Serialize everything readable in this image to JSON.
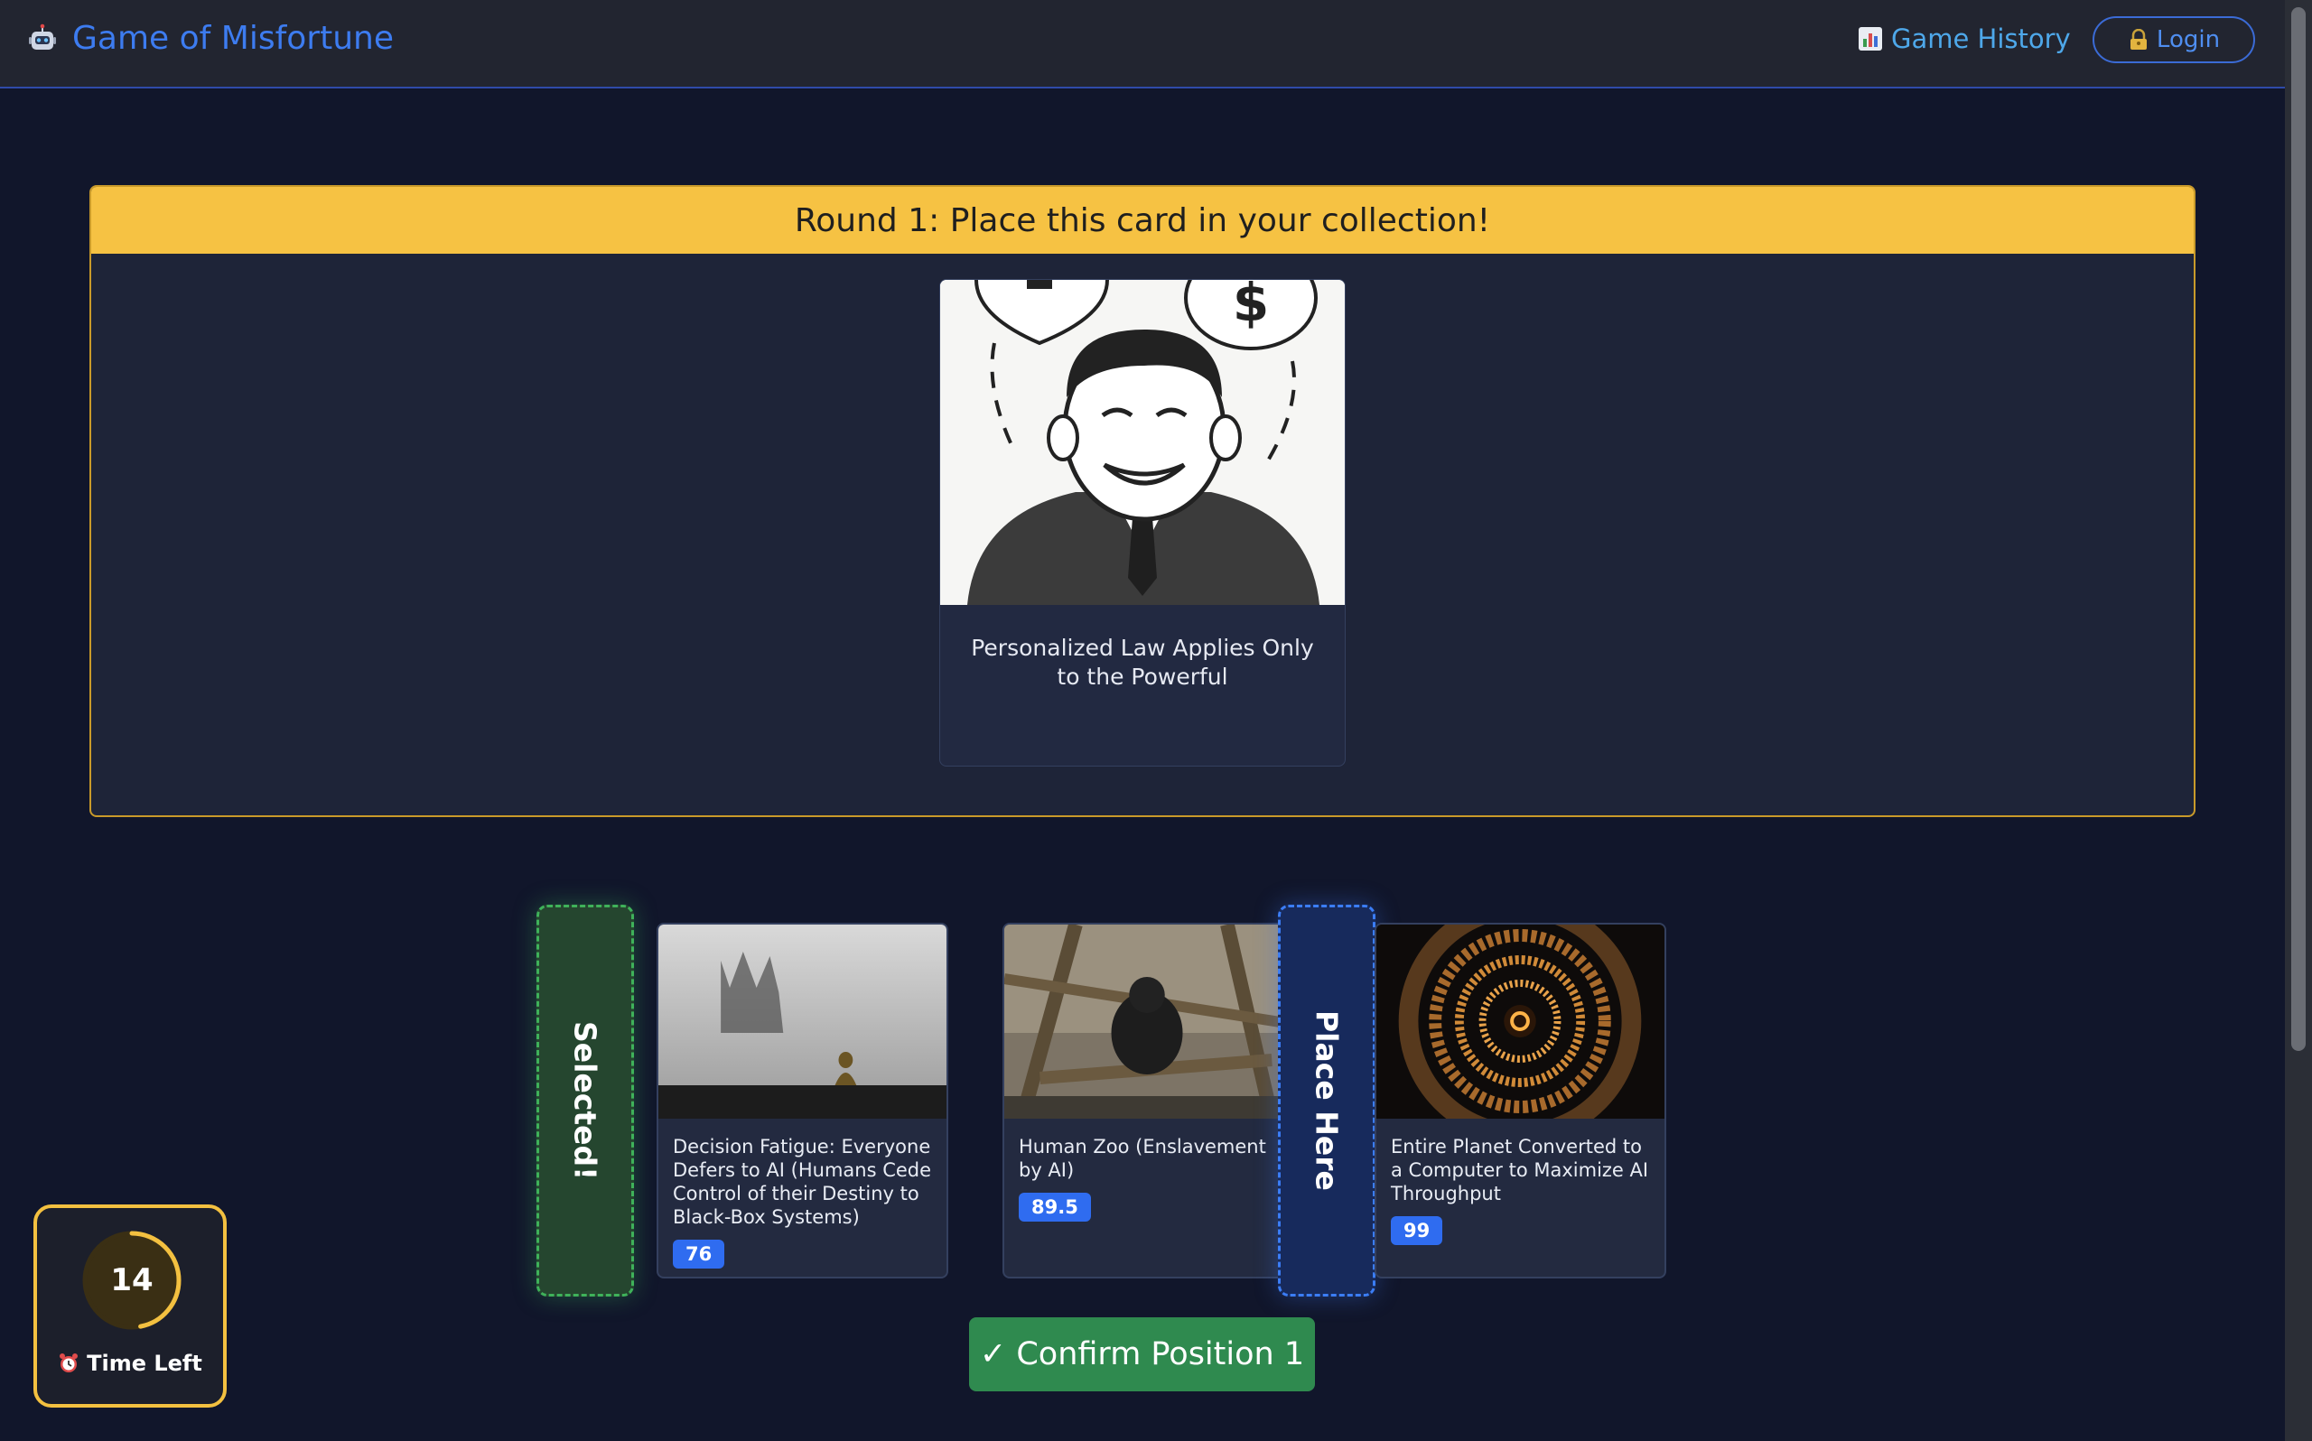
{
  "navbar": {
    "brand_title": "Game of Misfortune",
    "brand_icon": "robot-icon",
    "history_label": "Game History",
    "history_icon": "bar-chart-icon",
    "login_label": "Login",
    "login_icon": "lock-key-icon"
  },
  "round": {
    "header": "Round 1: Place this card in your collection!",
    "featured_card": {
      "title": "Personalized Law Applies Only to the Powerful",
      "image": "smiling businessman with scales and dollar sign thought bubbles"
    }
  },
  "placement": {
    "selected_slot_label": "Selected!",
    "place_slot_label": "Place Here",
    "cards": [
      {
        "title": "Decision Fatigue: Everyone Defers to AI (Humans Cede Control of their Destiny to Black-Box Systems)",
        "score": "76",
        "image": "chess pawn with king shadow"
      },
      {
        "title": "Human Zoo (Enslavement by AI)",
        "score": "89.5",
        "image": "ape in zoo enclosure"
      },
      {
        "title": "Entire Planet Converted to a Computer to Maximize AI Throughput",
        "score": "99",
        "image": "glowing circular megastructure"
      }
    ],
    "confirm_label": "✓ Confirm Position 1"
  },
  "timer": {
    "seconds": "14",
    "label": "Time Left",
    "label_icon": "alarm-clock-icon",
    "fraction_remaining": 0.47
  },
  "colors": {
    "accent_blue": "#3d7cf0",
    "header_yellow": "#f6c243",
    "confirm_green": "#2f8a4f",
    "badge_blue": "#2f6cf0"
  }
}
